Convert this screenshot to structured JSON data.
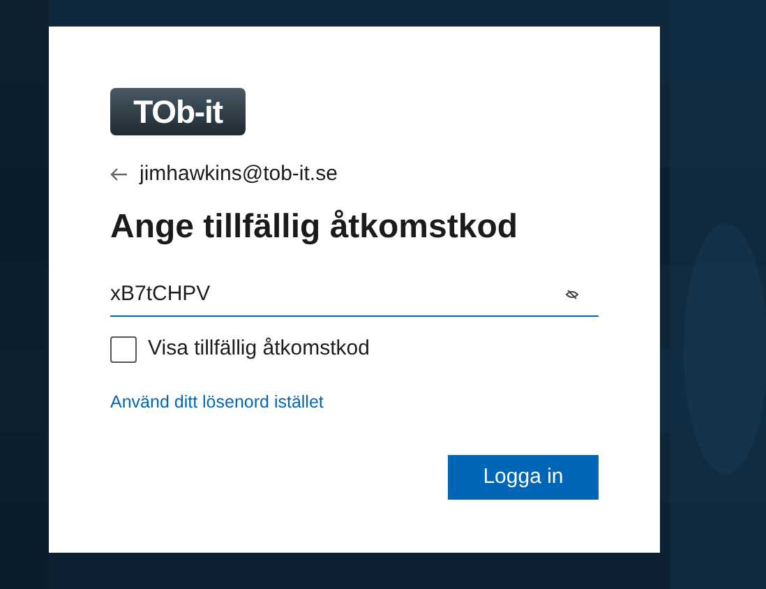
{
  "logo": {
    "text": "TOb-it"
  },
  "back": {
    "email": "jimhawkins@tob-it.se"
  },
  "title": "Ange tillfällig åtkomstkod",
  "code_field": {
    "value": "xB7tCHPV"
  },
  "show_code": {
    "label": "Visa tillfällig åtkomstkod",
    "checked": false
  },
  "password_link": "Använd ditt lösenord istället",
  "buttons": [
    {
      "label": "Logga in"
    }
  ]
}
